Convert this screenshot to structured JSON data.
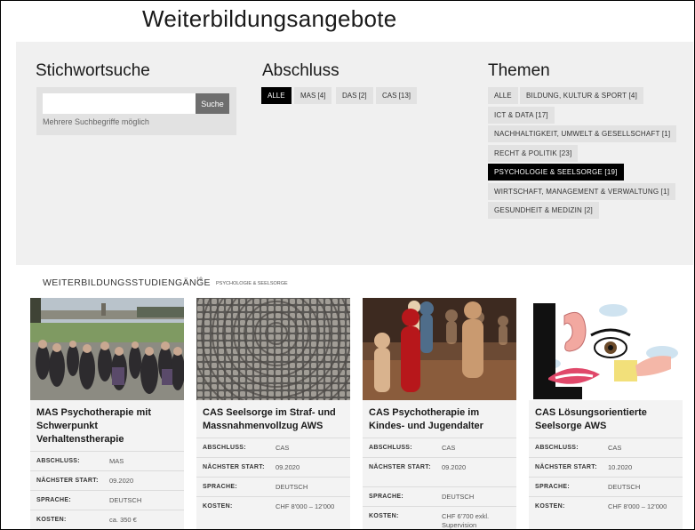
{
  "page_title": "Weiterbildungsangebote",
  "search": {
    "title": "Stichwortsuche",
    "placeholder": "",
    "button_label": "Suche",
    "hint": "Mehrere Suchbegriffe möglich"
  },
  "abschluss": {
    "title": "Abschluss",
    "options": [
      "ALLE",
      "MAS [4]",
      "DAS [2]",
      "CAS [13]"
    ],
    "active_index": 0
  },
  "themen": {
    "title": "Themen",
    "options": [
      "ALLE",
      "Bildung, Kultur & Sport [4]",
      "ICT & Data [17]",
      "Nachhaltigkeit, Umwelt & Gesellschaft [1]",
      "Recht & Politik [23]",
      "Psychologie & Seelsorge [19]",
      "Wirtschaft, Management & Verwaltung [1]",
      "Gesundheit & Medizin [2]"
    ],
    "active_index": 5
  },
  "results": {
    "heading": "Weiterbildungsstudiengänge",
    "count": "19",
    "topic": "Psychologie & Seelsorge"
  },
  "labels": {
    "abschluss": "Abschluss:",
    "start": "Nächster Start:",
    "sprache": "Sprache:",
    "kosten": "Kosten:"
  },
  "courses": [
    {
      "title": "MAS Psychotherapie mit Schwerpunkt Verhaltenstherapie",
      "image": "crowd-photo",
      "abschluss": "MAS",
      "start": "09.2020",
      "sprache": "DEUTSCH",
      "kosten": "ca. 350 €"
    },
    {
      "title": "CAS Seelsorge im Straf- und Massnahmenvollzug AWS",
      "image": "cobblestone-photo",
      "abschluss": "CAS",
      "start": "09.2020",
      "sprache": "DEUTSCH",
      "kosten": "CHF 8'000 – 12'000"
    },
    {
      "title": "CAS Psychotherapie im Kindes- und Jugendalter",
      "image": "wooden-figures-photo",
      "abschluss": "CAS",
      "start": "09.2020",
      "sprache": "DEUTSCH",
      "kosten": "CHF 6'700 exkl. Supervision"
    },
    {
      "title": "CAS Lösungsorientierte Seelsorge AWS",
      "image": "face-illustration",
      "abschluss": "CAS",
      "start": "10.2020",
      "sprache": "DEUTSCH",
      "kosten": "CHF 8'000 – 12'000"
    }
  ]
}
